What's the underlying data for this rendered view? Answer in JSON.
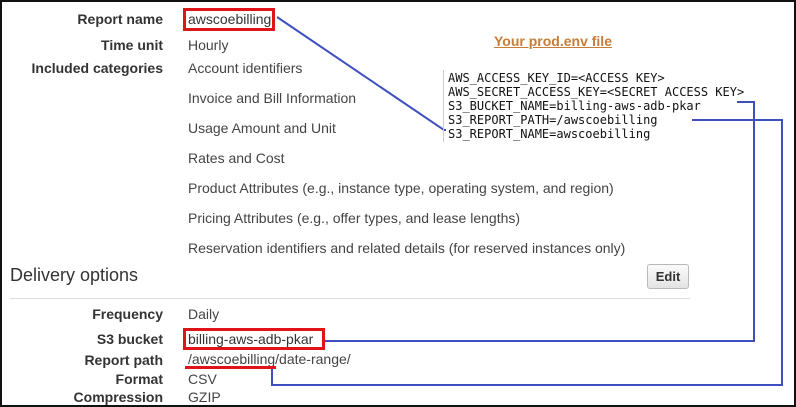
{
  "report": {
    "name_label": "Report name",
    "name_value": "awscoebilling",
    "time_unit_label": "Time unit",
    "time_unit_value": "Hourly",
    "categories_label": "Included categories",
    "categories": [
      "Account identifiers",
      "Invoice and Bill Information",
      "Usage Amount and Unit",
      "Rates and Cost",
      "Product Attributes (e.g., instance type, operating system, and region)",
      "Pricing Attributes (e.g., offer types, and lease lengths)",
      "Reservation identifiers and related details (for reserved instances only)"
    ]
  },
  "delivery": {
    "title": "Delivery options",
    "edit_label": "Edit",
    "frequency_label": "Frequency",
    "frequency_value": "Daily",
    "bucket_label": "S3 bucket",
    "bucket_value": "billing-aws-adb-pkar",
    "path_label": "Report path",
    "path_value": "/awscoebilling/date-range/",
    "format_label": "Format",
    "format_value": "CSV",
    "compression_label": "Compression",
    "compression_value": "GZIP"
  },
  "env_file": {
    "title": "Your prod.env file",
    "lines": [
      "AWS_ACCESS_KEY_ID=<ACCESS KEY>",
      "AWS_SECRET_ACCESS_KEY=<SECRET ACCESS KEY>",
      "S3_BUCKET_NAME=billing-aws-adb-pkar",
      "S3_REPORT_PATH=/awscoebilling",
      "S3_REPORT_NAME=awscoebilling"
    ]
  },
  "colors": {
    "highlight": "#e0131b",
    "connector": "#3f4fbf",
    "env_title": "#c67d3a"
  }
}
